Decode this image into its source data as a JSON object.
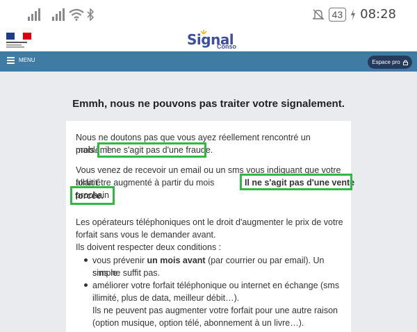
{
  "status_bar": {
    "battery": "43",
    "time": "08:28"
  },
  "header": {
    "brand_title": "Signal",
    "brand_sub": "Conso",
    "gov_logo_text": "RÉPUBLIQUE FRANÇAISE"
  },
  "nav": {
    "menu_label": "MENU",
    "pro_button": "Espace pro"
  },
  "main": {
    "title": "Emmh, nous ne pouvons pas traiter votre signalement.",
    "p1_line1": "Nous ne doutons pas que vous ayez réellement rencontré un problème",
    "p1_line2_a": "mais…",
    "p1_line2_b": "il ne s'agit pas d'une fraude.",
    "p2_line1": "Vous venez de recevoir un email ou un sms vous indiquant que votre forfait",
    "p2_line2": "allait être augmenté à partir du mois prochain",
    "p2_bold1": "Il ne s'agit pas d'une vente",
    "p2_bold2": "forcée.",
    "p3_line1": "Les opérateurs téléphoniques ont le droit d'augmenter le prix de votre",
    "p3_line2": "forfait sans vous le demander avant.",
    "p3_line3": "Ils doivent respecter deux conditions :",
    "b1_line1_a": "vous prévenir",
    "b1_line1_b": "un mois avant",
    "b1_line1_c": "(par courrier ou par email). Un simple",
    "b1_line2": "sms ne suffit pas.",
    "b2_line1": "améliorer votre forfait téléphonique ou internet en échange (sms",
    "b2_line2": "illimité, plus de data, meilleur débit…).",
    "b2_line3": "Ils ne peuvent pas augmenter votre forfait pour une autre raison",
    "b2_line4": "(option musique, option télé, abonnement à un livre…)."
  },
  "colors": {
    "nav": "#407ba4",
    "highlight": "#2fb842",
    "pro_button": "#253a5c",
    "brand": "#3d4ea3"
  }
}
